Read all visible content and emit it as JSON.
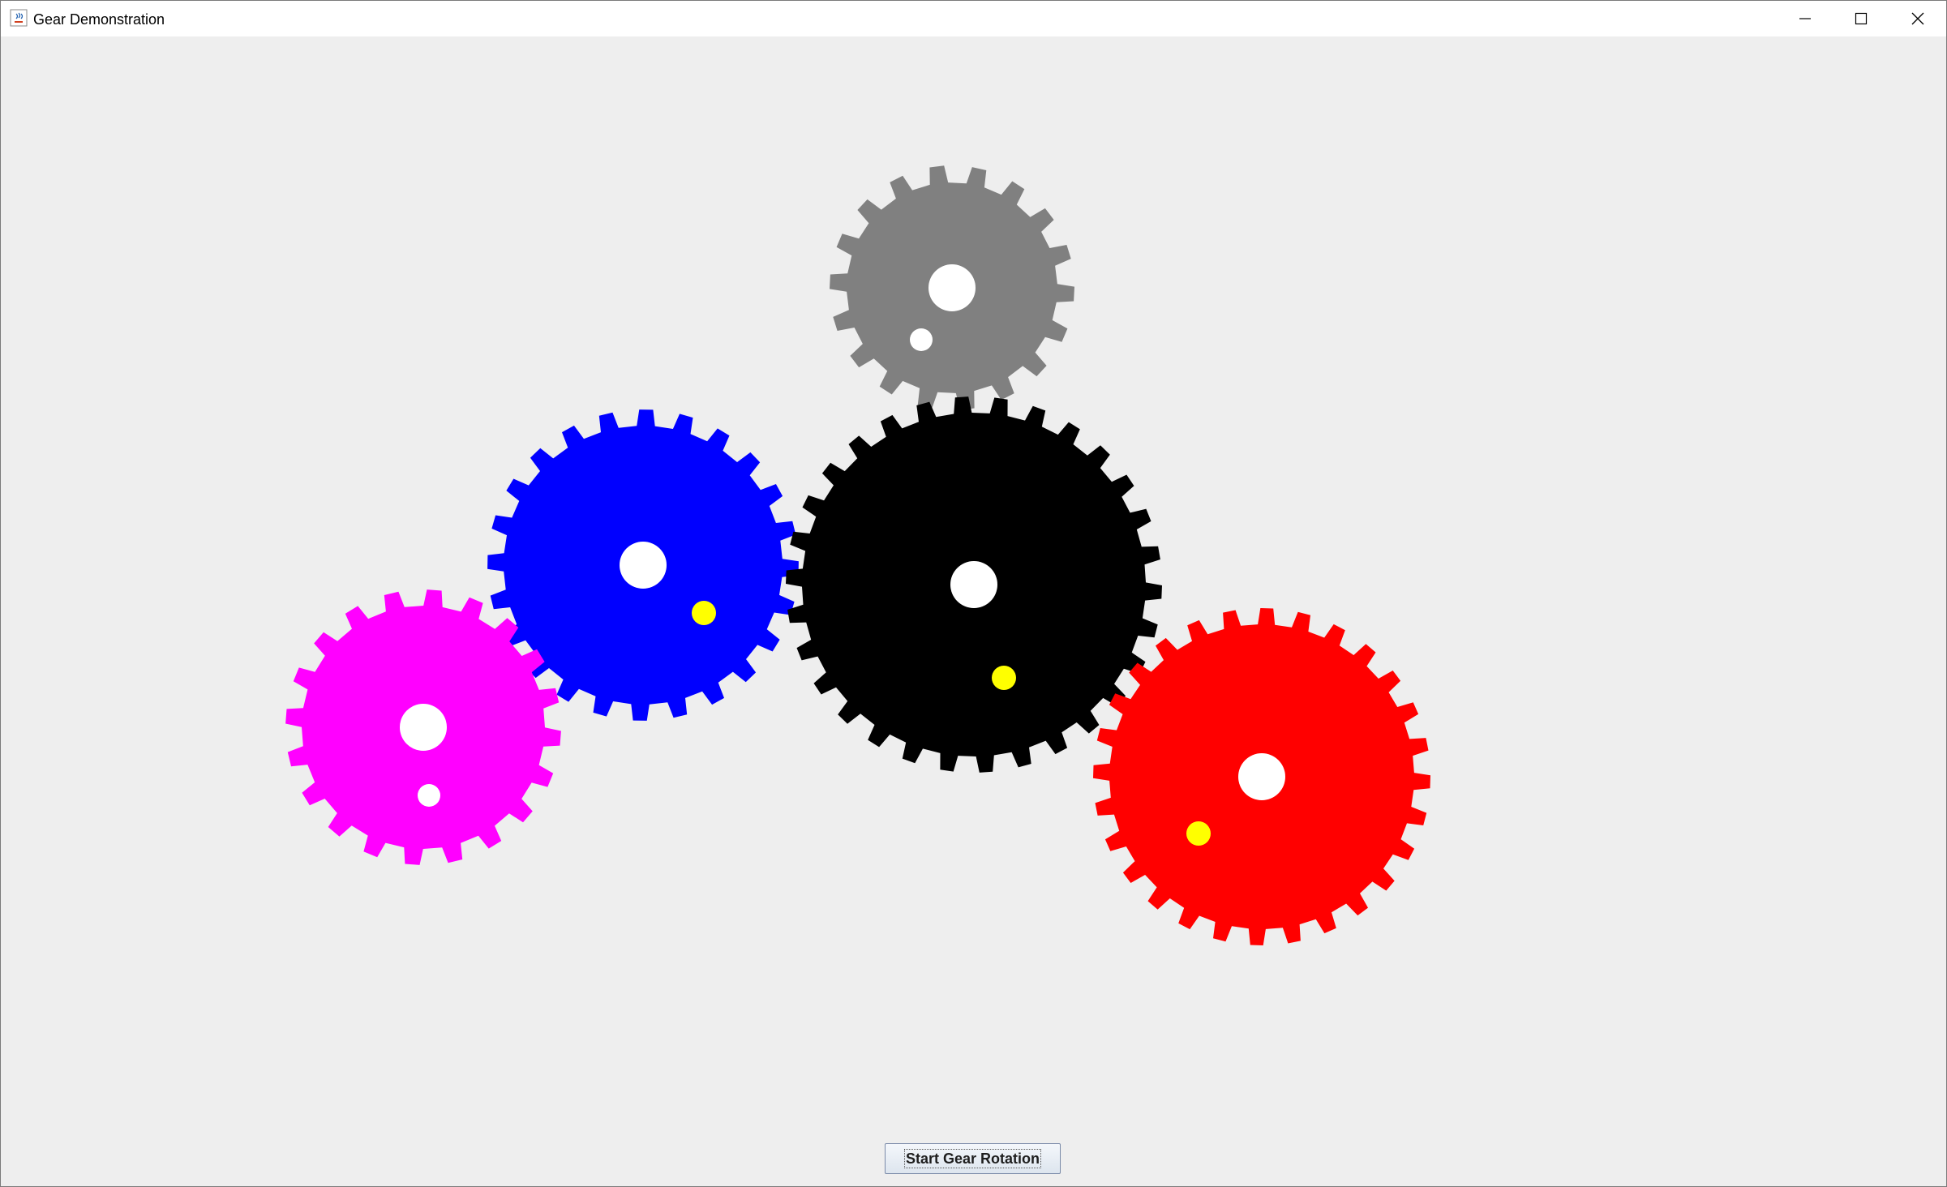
{
  "window": {
    "title": "Gear Demonstration",
    "icon": "java-app-icon",
    "controls": {
      "minimize": "minimize-icon",
      "maximize": "maximize-icon",
      "close": "close-icon"
    }
  },
  "gears": [
    {
      "name": "gray-gear",
      "color": "#808080",
      "teeth": 18,
      "has_marker": true,
      "marker_color": "#ffffff"
    },
    {
      "name": "blue-gear",
      "color": "#0000ff",
      "teeth": 24,
      "has_marker": true,
      "marker_color": "#ffff00"
    },
    {
      "name": "black-gear",
      "color": "#000000",
      "teeth": 30,
      "has_marker": true,
      "marker_color": "#ffff00"
    },
    {
      "name": "magenta-gear",
      "color": "#ff00ff",
      "teeth": 20,
      "has_marker": true,
      "marker_color": "#ffffff"
    },
    {
      "name": "red-gear",
      "color": "#ff0000",
      "teeth": 28,
      "has_marker": true,
      "marker_color": "#ffff00"
    }
  ],
  "controls": {
    "start_label": "Start Gear Rotation"
  },
  "colors": {
    "background": "#eeeeee",
    "hub": "#ffffff"
  }
}
